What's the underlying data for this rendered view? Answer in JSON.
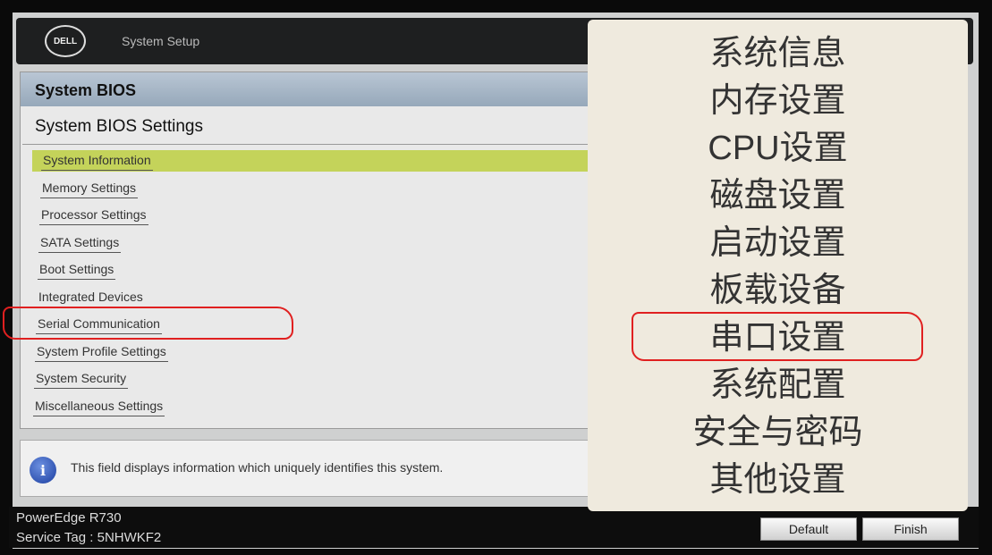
{
  "header": {
    "logo": "DELL",
    "title": "System Setup"
  },
  "panel": {
    "title": "System BIOS",
    "subtitle": "System BIOS Settings",
    "items": [
      "System Information",
      "Memory Settings",
      "Processor Settings",
      "SATA Settings",
      "Boot Settings",
      "Integrated Devices",
      "Serial Communication",
      "System Profile Settings",
      "System Security",
      "Miscellaneous Settings"
    ],
    "selected_index": 0
  },
  "info": {
    "icon": "info-icon",
    "text": "This field displays information which uniquely identifies this system."
  },
  "footer": {
    "model": "PowerEdge R730",
    "service_tag": "Service Tag : 5NHWKF2",
    "default_label": "Default",
    "finish_label": "Finish"
  },
  "overlay": {
    "items": [
      "系统信息",
      "内存设置",
      "CPU设置",
      "磁盘设置",
      "启动设置",
      "板载设备",
      "串口设置",
      "系统配置",
      "安全与密码",
      "其他设置"
    ],
    "highlight_index": 6
  },
  "colors": {
    "selection": "#c4d35a",
    "annotation": "#e02020",
    "overlay_bg": "#efeade"
  }
}
